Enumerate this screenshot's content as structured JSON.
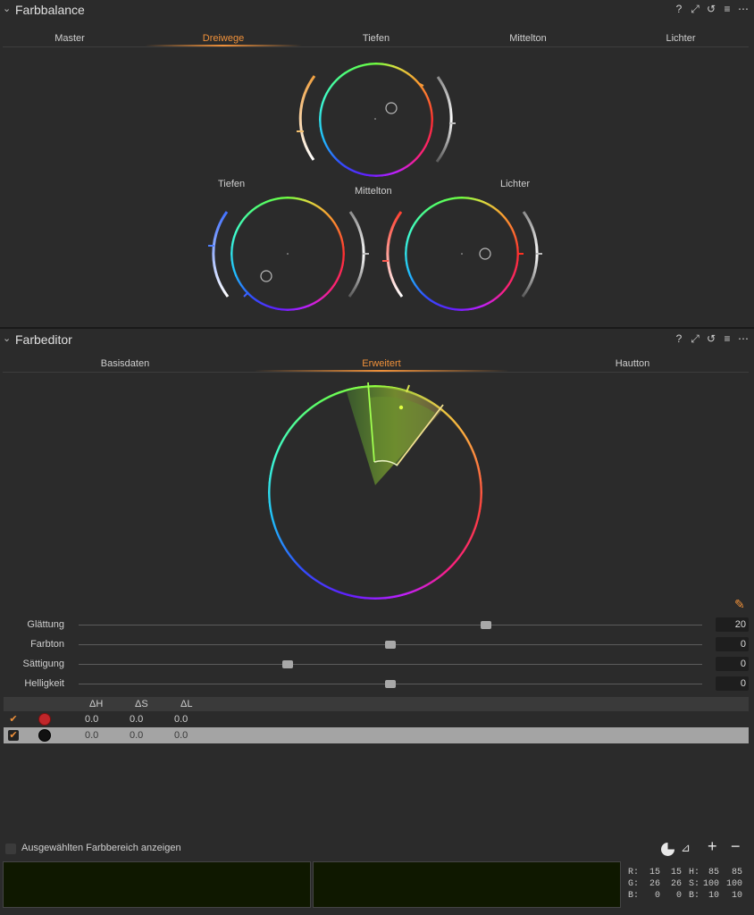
{
  "farbbalance": {
    "title": "Farbbalance",
    "toolbar": {
      "help": "?",
      "expand": "⤢",
      "reset": "↺",
      "menu": "≡",
      "more": "⋯"
    },
    "tabs": [
      "Master",
      "Dreiwege",
      "Tiefen",
      "Mittelton",
      "Lichter"
    ],
    "active_tab": "Dreiwege",
    "wheels": {
      "shadows_label": "Tiefen",
      "midtones_label": "Mittelton",
      "highlights_label": "Lichter"
    }
  },
  "farbeditor": {
    "title": "Farbeditor",
    "toolbar": {
      "help": "?",
      "expand": "⤢",
      "reset": "↺",
      "menu": "≡",
      "more": "⋯"
    },
    "tabs": [
      "Basisdaten",
      "Erweitert",
      "Hautton"
    ],
    "active_tab": "Erweitert",
    "sliders": [
      {
        "label": "Glättung",
        "value": "20",
        "position": 0.65
      },
      {
        "label": "Farbton",
        "value": "0",
        "position": 0.5
      },
      {
        "label": "Sättigung",
        "value": "0",
        "position": 0.335
      },
      {
        "label": "Helligkeit",
        "value": "0",
        "position": 0.5
      }
    ],
    "table": {
      "headers": [
        "ΔH",
        "ΔS",
        "ΔL"
      ],
      "rows": [
        {
          "checked": true,
          "swatch_color": "#c0262a",
          "dh": "0.0",
          "ds": "0.0",
          "dl": "0.0",
          "selected": false
        },
        {
          "checked": true,
          "swatch_color": "#111111",
          "dh": "0.0",
          "ds": "0.0",
          "dl": "0.0",
          "selected": true
        }
      ]
    },
    "show_range_label": "Ausgewählten Farbbereich anzeigen",
    "bottom_tools": {
      "add": "+",
      "remove": "−"
    }
  },
  "readout": {
    "rows": [
      {
        "a_label": "R:",
        "a1": "15",
        "a2": "15",
        "b_label": "H:",
        "b1": "85",
        "b2": "85"
      },
      {
        "a_label": "G:",
        "a1": "26",
        "a2": "26",
        "b_label": "S:",
        "b1": "100",
        "b2": "100"
      },
      {
        "a_label": "B:",
        "a1": "0",
        "a2": "0",
        "b_label": "B:",
        "b1": "10",
        "b2": "10"
      }
    ]
  },
  "colors": {
    "accent": "#f0913a",
    "background": "#2b2b2b",
    "preview": "#0f1800"
  }
}
